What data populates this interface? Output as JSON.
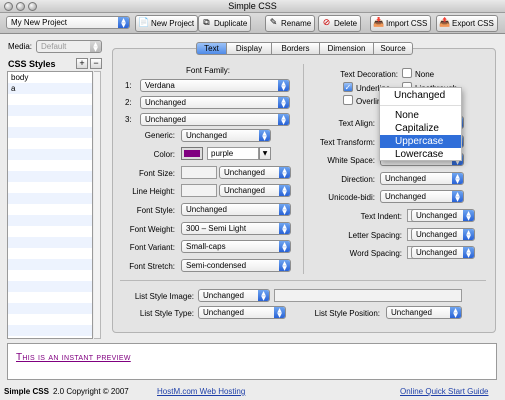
{
  "window": {
    "title": "Simple CSS"
  },
  "toolbar": {
    "project": "My New Project",
    "new_project": "New Project",
    "duplicate": "Duplicate",
    "rename": "Rename",
    "delete": "Delete",
    "import_css": "Import CSS",
    "export_css": "Export CSS"
  },
  "sidebar": {
    "media_label": "Media:",
    "media_value": "Default",
    "styles_heading": "CSS Styles",
    "add": "+",
    "remove": "−",
    "styles": [
      "body",
      "a"
    ]
  },
  "tabs": [
    "Text",
    "Display",
    "Borders",
    "Dimension",
    "Source"
  ],
  "font": {
    "family_heading": "Font Family:",
    "fam1_label": "1:",
    "fam1": "Verdana",
    "fam2_label": "2:",
    "fam2": "Unchanged",
    "fam3_label": "3:",
    "fam3": "Unchanged",
    "generic_label": "Generic:",
    "generic": "Unchanged",
    "color_label": "Color:",
    "color_value": "purple",
    "color_hex": "#800080",
    "size_label": "Font Size:",
    "size": "Unchanged",
    "line_height_label": "Line Height:",
    "line_height": "Unchanged",
    "style_label": "Font Style:",
    "style": "Unchanged",
    "weight_label": "Font Weight:",
    "weight": "300 – Semi Light",
    "variant_label": "Font Variant:",
    "variant": "Small-caps",
    "stretch_label": "Font Stretch:",
    "stretch": "Semi-condensed"
  },
  "text": {
    "decoration_label": "Text Decoration:",
    "none": "None",
    "underline": "Underline",
    "linethrough": "Linethrough",
    "overline": "Overline",
    "align_label": "Text Align:",
    "transform_label": "Text Transform:",
    "whitespace_label": "White Space:",
    "direction_label": "Direction:",
    "direction": "Unchanged",
    "unicode_bidi_label": "Unicode-bidi:",
    "unicode_bidi": "Unchanged",
    "indent_label": "Text Indent:",
    "indent": "Unchanged",
    "letter_spacing_label": "Letter Spacing:",
    "letter_spacing": "Unchanged",
    "word_spacing_label": "Word Spacing:",
    "word_spacing": "Unchanged"
  },
  "transform_menu": {
    "items": [
      "Unchanged",
      "None",
      "Capitalize",
      "Uppercase",
      "Lowercase"
    ],
    "selected": "Uppercase"
  },
  "list": {
    "image_label": "List Style Image:",
    "image": "Unchanged",
    "type_label": "List Style Type:",
    "type": "Unchanged",
    "position_label": "List Style Position:",
    "position": "Unchanged"
  },
  "preview": {
    "text": "This is an instant preview"
  },
  "status": {
    "app": "Simple CSS",
    "text": "2.0 Copyright © 2007",
    "host_link": "HostM.com Web Hosting",
    "guide_link": "Online Quick Start Guide"
  }
}
